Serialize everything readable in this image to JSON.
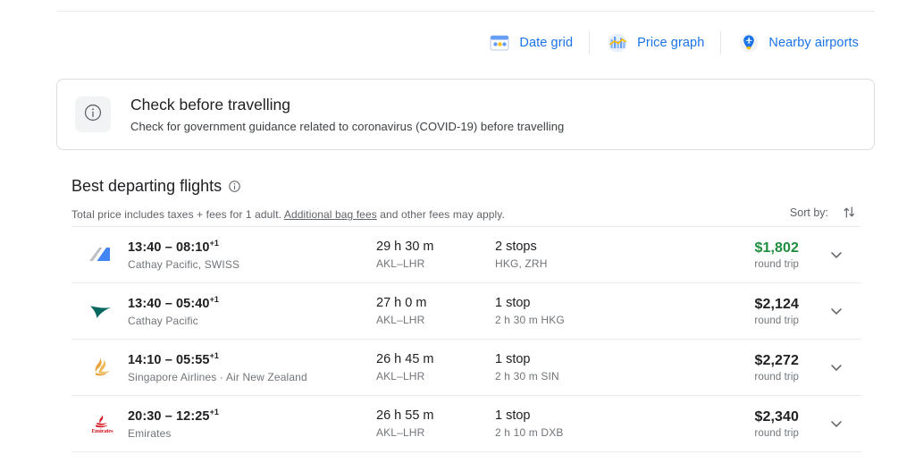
{
  "tools": [
    {
      "label": "Date grid",
      "icon": "date-grid-icon"
    },
    {
      "label": "Price graph",
      "icon": "price-graph-icon"
    },
    {
      "label": "Nearby airports",
      "icon": "nearby-airports-icon"
    }
  ],
  "notice": {
    "icon": "info-icon",
    "title": "Check before travelling",
    "subtitle": "Check for government guidance related to coronavirus (COVID-19) before travelling"
  },
  "best_departing": {
    "title": "Best departing flights",
    "info_icon": "info-icon",
    "subtitle_prefix": "Total price includes taxes + fees for 1 adult. ",
    "subtitle_link": "Additional bag fees",
    "subtitle_suffix": " and other fees may apply.",
    "sort_label": "Sort by:",
    "sort_icon": "sort-arrows-icon"
  },
  "colors": {
    "link_blue": "#1a73e8",
    "best_price_green": "#1e8e3e",
    "text_primary": "#202124",
    "text_secondary": "#70757a",
    "border": "#e8eaed"
  },
  "flights": [
    {
      "logo": "cathay-pacific-swiss-logo",
      "times": "13:40 – 08:10",
      "day_offset": "+1",
      "airlines": "Cathay Pacific, SWISS",
      "duration": "29 h 30 m",
      "route": "AKL–LHR",
      "stops": "2 stops",
      "stop_detail": "HKG, ZRH",
      "price": "$1,802",
      "price_note": "round trip",
      "best_price": true,
      "expand_icon": "chevron-down-icon"
    },
    {
      "logo": "cathay-pacific-logo",
      "times": "13:40 – 05:40",
      "day_offset": "+1",
      "airlines": "Cathay Pacific",
      "duration": "27 h 0 m",
      "route": "AKL–LHR",
      "stops": "1 stop",
      "stop_detail": "2 h 30 m HKG",
      "price": "$2,124",
      "price_note": "round trip",
      "best_price": false,
      "expand_icon": "chevron-down-icon"
    },
    {
      "logo": "singapore-airlines-logo",
      "times": "14:10 – 05:55",
      "day_offset": "+1",
      "airlines": "Singapore Airlines  ·  Air New Zealand",
      "duration": "26 h 45 m",
      "route": "AKL–LHR",
      "stops": "1 stop",
      "stop_detail": "2 h 30 m SIN",
      "price": "$2,272",
      "price_note": "round trip",
      "best_price": false,
      "expand_icon": "chevron-down-icon"
    },
    {
      "logo": "emirates-logo",
      "times": "20:30 – 12:25",
      "day_offset": "+1",
      "airlines": "Emirates",
      "duration": "26 h 55 m",
      "route": "AKL–LHR",
      "stops": "1 stop",
      "stop_detail": "2 h 10 m DXB",
      "price": "$2,340",
      "price_note": "round trip",
      "best_price": false,
      "expand_icon": "chevron-down-icon"
    }
  ]
}
